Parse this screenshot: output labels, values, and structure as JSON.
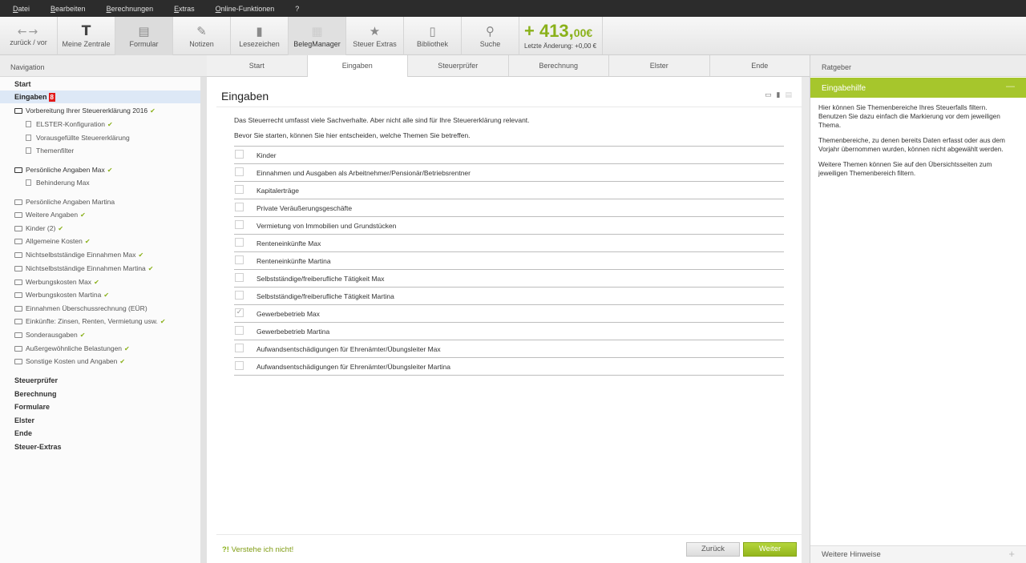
{
  "menu": [
    "Datei",
    "Bearbeiten",
    "Berechnungen",
    "Extras",
    "Online-Funktionen",
    "?"
  ],
  "toolbar": {
    "back_label": "zurück / vor",
    "buttons": [
      {
        "label": "Meine Zentrale",
        "icon": "T"
      },
      {
        "label": "Formular",
        "icon": "▤"
      },
      {
        "label": "Notizen",
        "icon": "✎"
      },
      {
        "label": "Lesezeichen",
        "icon": "▮"
      },
      {
        "label": "BelegManager",
        "icon": "▦"
      },
      {
        "label": "Steuer Extras",
        "icon": "★"
      },
      {
        "label": "Bibliothek",
        "icon": "▯"
      },
      {
        "label": "Suche",
        "icon": "⚲"
      }
    ],
    "amount_main": "+ 413,",
    "amount_cents": "00€",
    "amount_sub": "Letzte Änderung: +0,00 €",
    "amount_color": "#8ab11a"
  },
  "nav": {
    "header": "Navigation",
    "start": "Start",
    "current": "Eingaben",
    "current_badge": "8",
    "section1": "Vorbereitung Ihrer Steuererklärung 2016",
    "sub1": [
      "ELSTER-Konfiguration",
      "Vorausgefüllte Steuererklärung",
      "Themenfilter"
    ],
    "section2": "Persönliche Angaben Max",
    "sub2": [
      "Behinderung Max"
    ],
    "folders": [
      "Persönliche Angaben Martina",
      "Weitere Angaben",
      "Kinder (2)",
      "Allgemeine Kosten",
      "Nichtselbstständige Einnahmen Max",
      "Nichtselbstständige Einnahmen Martina",
      "Werbungskosten Max",
      "Werbungskosten Martina",
      "Einnahmen Überschussrechnung (EÜR)",
      "Einkünfte: Zinsen, Renten, Vermietung usw.",
      "Sonderausgaben",
      "Außergewöhnliche Belastungen",
      "Sonstige Kosten und Angaben"
    ],
    "bottom": [
      "Steuerprüfer",
      "Berechnung",
      "Formulare",
      "Elster",
      "Ende",
      "Steuer-Extras"
    ]
  },
  "tabs": [
    "Start",
    "Eingaben",
    "Steuerprüfer",
    "Berechnung",
    "Elster",
    "Ende"
  ],
  "main": {
    "title": "Eingaben",
    "intro1": "Das Steuerrecht umfasst viele Sachverhalte. Aber nicht alle sind für Ihre Steuererklärung relevant.",
    "intro2": "Bevor Sie starten, können Sie hier entscheiden, welche Themen Sie betreffen.",
    "topics": [
      {
        "label": "Kinder",
        "checked": false
      },
      {
        "label": "Einnahmen und Ausgaben als Arbeitnehmer/Pensionär/Betriebsrentner",
        "checked": false
      },
      {
        "label": "Kapitalerträge",
        "checked": false
      },
      {
        "label": "Private Veräußerungsgeschäfte",
        "checked": false
      },
      {
        "label": "Vermietung von Immobilien und Grundstücken",
        "checked": false
      },
      {
        "label": "Renteneinkünfte Max",
        "checked": false
      },
      {
        "label": "Renteneinkünfte Martina",
        "checked": false
      },
      {
        "label": "Selbstständige/freiberufliche Tätigkeit Max",
        "checked": false
      },
      {
        "label": "Selbstständige/freiberufliche Tätigkeit Martina",
        "checked": false
      },
      {
        "label": "Gewerbebetrieb Max",
        "checked": true
      },
      {
        "label": "Gewerbebetrieb Martina",
        "checked": false
      },
      {
        "label": "Aufwandsentschädigungen für Ehrenämter/Übungsleiter Max",
        "checked": false
      },
      {
        "label": "Aufwandsentschädigungen für Ehrenämter/Übungsleiter Martina",
        "checked": false
      }
    ],
    "help_mark": "?!",
    "help_text": "Verstehe ich nicht!",
    "back_button": "Zurück",
    "next_button": "Weiter"
  },
  "right": {
    "header": "Ratgeber",
    "panel_title": "Eingabehilfe",
    "p1": "Hier können Sie Themenbereiche Ihres Steuerfalls filtern. Benutzen Sie dazu einfach die Markierung vor dem jeweiligen Thema.",
    "p2": "Themenbereiche, zu denen bereits Daten erfasst oder aus dem Vorjahr übernommen wurden, können nicht abgewählt werden.",
    "p3": "Weitere Themen können Sie auf den Übersichtsseiten zum jeweiligen Themenbereich filtern.",
    "more": "Weitere Hinweise"
  }
}
